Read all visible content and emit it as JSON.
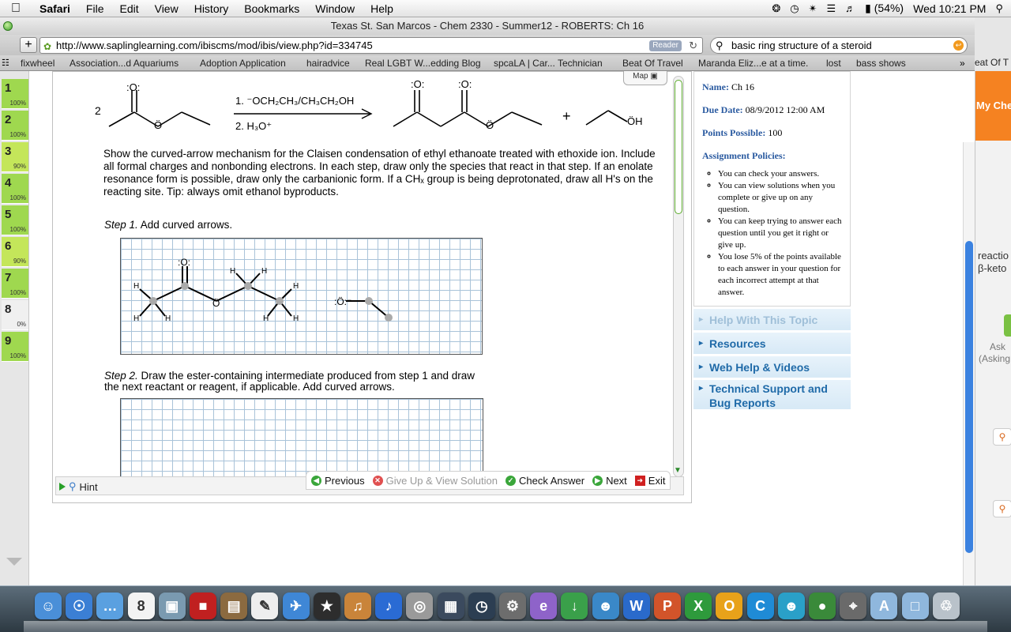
{
  "menubar": {
    "apple": "",
    "app_name": "Safari",
    "items": [
      "File",
      "Edit",
      "View",
      "History",
      "Bookmarks",
      "Window",
      "Help"
    ],
    "battery": "(54%)",
    "clock": "Wed 10:21 PM"
  },
  "window": {
    "title": "Texas St. San Marcos - Chem 2330 - Summer12 - ROBERTS: Ch 16",
    "url": "http://www.saplinglearning.com/ibiscms/mod/ibis/view.php?id=334745",
    "reader_label": "Reader",
    "search_value": "basic ring structure of a steroid"
  },
  "bookmarks": [
    "fixwheel",
    "Association...d Aquariums",
    "Adoption Application",
    "hairadvice",
    "Real LGBT W...edding Blog",
    "spcaLA | Car... Technician",
    "Beat Of Travel",
    "Maranda Eliz...e at a time.",
    "lost",
    "bass shows"
  ],
  "bookmarks_overflow": "»",
  "bookmarks_peek": "eat Of T",
  "questions": [
    {
      "num": "1",
      "pct": "100%",
      "color": "#9fd84f"
    },
    {
      "num": "2",
      "pct": "100%",
      "color": "#9fd84f"
    },
    {
      "num": "3",
      "pct": "90%",
      "color": "#c4e65a"
    },
    {
      "num": "4",
      "pct": "100%",
      "color": "#9fd84f"
    },
    {
      "num": "5",
      "pct": "100%",
      "color": "#9fd84f"
    },
    {
      "num": "6",
      "pct": "90%",
      "color": "#c4e65a"
    },
    {
      "num": "7",
      "pct": "100%",
      "color": "#9fd84f"
    },
    {
      "num": "8",
      "pct": "0%",
      "color": "#f0f0f0"
    },
    {
      "num": "9",
      "pct": "100%",
      "color": "#9fd84f"
    }
  ],
  "reaction": {
    "coefficient": "2",
    "reagent1": "1. ⁻OCH₂CH₃/CH₃CH₂OH",
    "reagent2": "2. H₃O⁺",
    "plus": "+",
    "oh_label": "ÖH",
    "o_label": ":O:",
    "o_dot_label": "Ö"
  },
  "map_label": "Map",
  "question_text": "Show the curved-arrow mechanism for the Claisen condensation of ethyl ethanoate treated with ethoxide ion. Include all formal charges and nonbonding electrons. In each step, draw only the species that react in that step. If an enolate resonance form is possible, draw only the carbanionic form. If a CHₓ group is being deprotonated, draw all H's on the reacting site. Tip: always omit ethanol byproducts.",
  "step1": {
    "label": "Step 1.",
    "text": "Add curved arrows."
  },
  "step2": {
    "label": "Step 2.",
    "text": "Draw the ester-containing intermediate produced from step 1 and draw the next reactant or reagent, if applicable. Add curved arrows."
  },
  "canvas1": {
    "h": "H",
    "o_top": ":O:",
    "o_mid": "Ö",
    "ethoxide": ":Ö:⁻"
  },
  "bottom_bar": {
    "hint": "Hint",
    "previous": "Previous",
    "give_up": "Give Up & View Solution",
    "check": "Check Answer",
    "next": "Next",
    "exit": "Exit"
  },
  "assignment": {
    "name_label": "Name:",
    "name_value": "Ch 16",
    "due_label": "Due Date:",
    "due_value": "08/9/2012 12:00 AM",
    "points_label": "Points Possible:",
    "points_value": "100",
    "policies_label": "Assignment Policies:",
    "policies": [
      "You can check your answers.",
      "You can view solutions when you complete or give up on any question.",
      "You can keep trying to answer each question until you get it right or give up.",
      "You lose 5% of the points available to each answer in your question for each incorrect attempt at that answer."
    ]
  },
  "side_links": [
    "Help With This Topic",
    "Resources",
    "Web Help & Videos",
    "Technical Support and Bug Reports"
  ],
  "right_peek": {
    "cheg": "My Cheg",
    "text1a": "reactio",
    "text1b": "β-keto",
    "text2a": "Ask",
    "text2b": "(Asking"
  },
  "dock_icons": [
    {
      "name": "finder-icon",
      "color": "#4a8fd8",
      "glyph": "☺"
    },
    {
      "name": "safari-icon",
      "color": "#3b7fd4",
      "glyph": "☉"
    },
    {
      "name": "ichat-icon",
      "color": "#5aa0e0",
      "glyph": "…"
    },
    {
      "name": "ical-icon",
      "color": "#f3f3f3",
      "glyph": "8"
    },
    {
      "name": "iphoto-icon",
      "color": "#7a9ab0",
      "glyph": "▣"
    },
    {
      "name": "photobooth-icon",
      "color": "#c02020",
      "glyph": "■"
    },
    {
      "name": "preview-icon",
      "color": "#8b6a40",
      "glyph": "▤"
    },
    {
      "name": "textedit-icon",
      "color": "#eeeeee",
      "glyph": "✎"
    },
    {
      "name": "mail-icon",
      "color": "#3f87d6",
      "glyph": "✈"
    },
    {
      "name": "imovie-icon",
      "color": "#2d2d2d",
      "glyph": "★"
    },
    {
      "name": "garageband-icon",
      "color": "#c9843a",
      "glyph": "♫"
    },
    {
      "name": "itunes-icon",
      "color": "#2a6bd4",
      "glyph": "♪"
    },
    {
      "name": "dvd-player-icon",
      "color": "#9a9a9a",
      "glyph": "◎"
    },
    {
      "name": "dashboard-icon",
      "color": "#3b4a5e",
      "glyph": "▦"
    },
    {
      "name": "time-machine-icon",
      "color": "#2c3e52",
      "glyph": "◷"
    },
    {
      "name": "system-preferences-icon",
      "color": "#6d6d6d",
      "glyph": "⚙"
    },
    {
      "name": "skype-e-icon",
      "color": "#8e63c9",
      "glyph": "e"
    },
    {
      "name": "download-globe-icon",
      "color": "#3aa04a",
      "glyph": "↓"
    },
    {
      "name": "people-icon",
      "color": "#3a88c8",
      "glyph": "☻"
    },
    {
      "name": "word-icon",
      "color": "#2a6acb",
      "glyph": "W"
    },
    {
      "name": "powerpoint-icon",
      "color": "#d2542a",
      "glyph": "P"
    },
    {
      "name": "excel-icon",
      "color": "#2e9a3c",
      "glyph": "X"
    },
    {
      "name": "outlook-icon",
      "color": "#e8a21a",
      "glyph": "O"
    },
    {
      "name": "communicator-icon",
      "color": "#1f8bd6",
      "glyph": "C"
    },
    {
      "name": "messenger-icon",
      "color": "#2aa0c8",
      "glyph": "☻"
    },
    {
      "name": "network-globe-icon",
      "color": "#3a8a3a",
      "glyph": "●"
    },
    {
      "name": "satellite-icon",
      "color": "#6a6a6a",
      "glyph": "⌖"
    },
    {
      "name": "applications-folder-icon",
      "color": "#8fb7dd",
      "glyph": "A"
    },
    {
      "name": "documents-folder-icon",
      "color": "#8fb7dd",
      "glyph": "□"
    },
    {
      "name": "trash-icon",
      "color": "#b9c2ca",
      "glyph": "♲"
    }
  ]
}
